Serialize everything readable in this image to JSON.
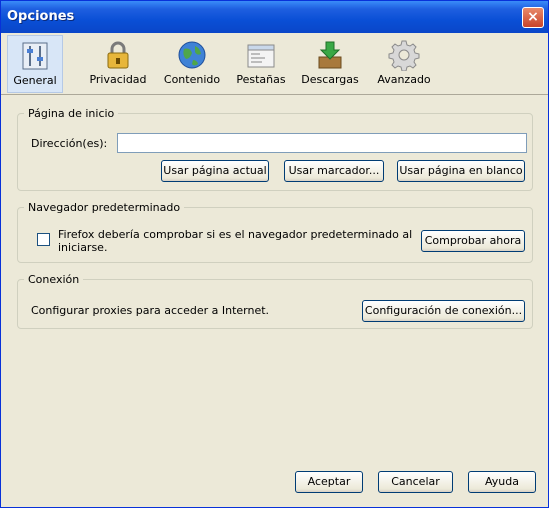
{
  "window": {
    "title": "Opciones",
    "close_glyph": "×"
  },
  "toolbar": {
    "items": [
      {
        "label": "General",
        "icon": "general-settings-icon",
        "selected": true
      },
      {
        "label": "Privacidad",
        "icon": "padlock-icon",
        "selected": false
      },
      {
        "label": "Contenido",
        "icon": "globe-icon",
        "selected": false
      },
      {
        "label": "Pestañas",
        "icon": "tabs-window-icon",
        "selected": false
      },
      {
        "label": "Descargas",
        "icon": "download-box-icon",
        "selected": false
      },
      {
        "label": "Avanzado",
        "icon": "gear-icon",
        "selected": false
      }
    ]
  },
  "home_page": {
    "legend": "Página de inicio",
    "address_label": "Dirección(es):",
    "address_value": "",
    "use_current_button": "Usar página actual",
    "use_bookmark_button": "Usar marcador...",
    "use_blank_button": "Usar página en blanco"
  },
  "default_browser": {
    "legend": "Navegador predeterminado",
    "checkbox_line1": "Firefox debería comprobar si es el navegador predeterminado al",
    "checkbox_line2": "iniciarse.",
    "checked": false,
    "check_now_button": "Comprobar ahora"
  },
  "connection": {
    "legend": "Conexión",
    "description": "Configurar proxies para acceder a Internet.",
    "settings_button": "Configuración de conexión..."
  },
  "footer": {
    "ok_button": "Aceptar",
    "cancel_button": "Cancelar",
    "help_button": "Ayuda"
  },
  "colors": {
    "titlebar": "#0a4fd6",
    "window_bg": "#ece9d8",
    "selected_tab_bg": "#d8e6f7",
    "close_button": "#c9432a"
  }
}
